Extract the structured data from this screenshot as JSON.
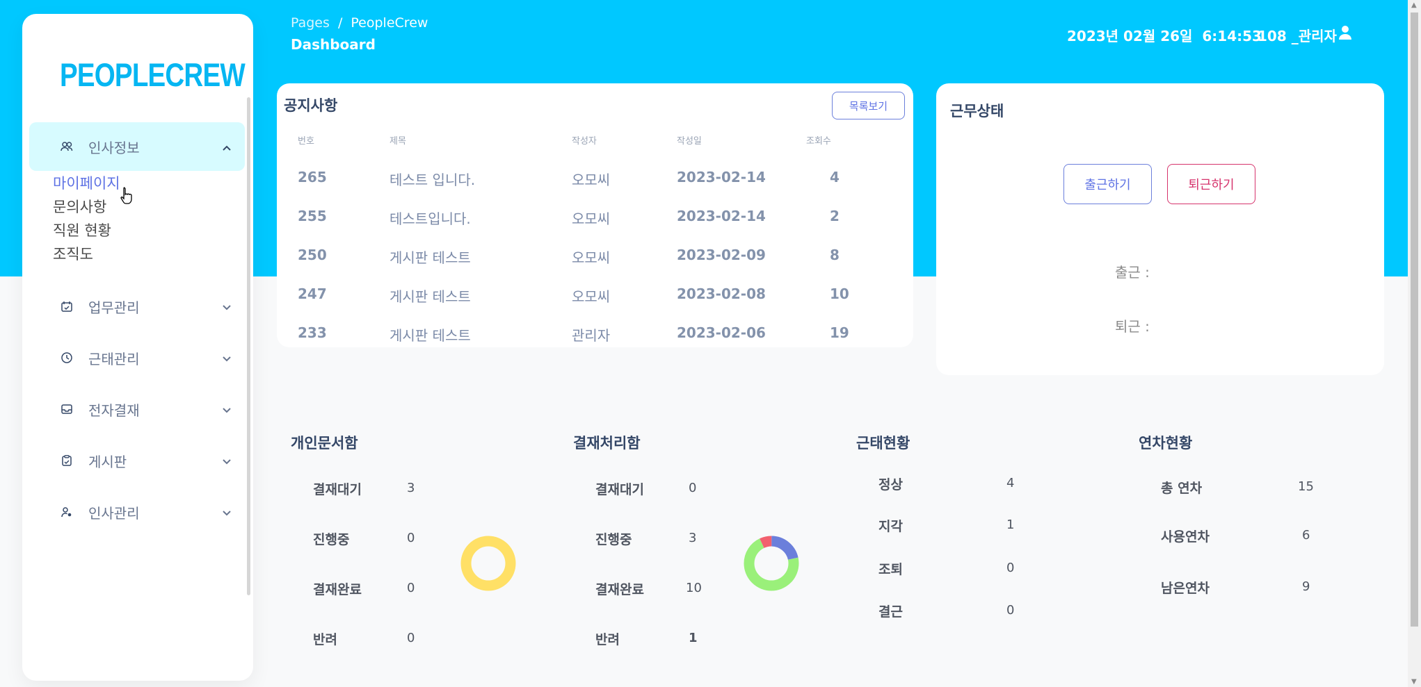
{
  "brand": {
    "logo": "PEOPLECREW"
  },
  "header": {
    "breadcrumb_root": "Pages",
    "breadcrumb_sep": "/",
    "breadcrumb_current": "PeopleCrew",
    "page_title": "Dashboard",
    "datetime": "2023년 02월 26일  6:14:53",
    "user": "108 _관리자"
  },
  "sidebar": {
    "items": [
      {
        "label": "인사정보",
        "icon": "people-icon",
        "expanded": true
      },
      {
        "label": "업무관리",
        "icon": "calendar-check-icon"
      },
      {
        "label": "근태관리",
        "icon": "clock-icon"
      },
      {
        "label": "전자결재",
        "icon": "inbox-icon"
      },
      {
        "label": "게시판",
        "icon": "clipboard-icon"
      },
      {
        "label": "인사관리",
        "icon": "user-gear-icon"
      }
    ],
    "sub_items": [
      "마이페이지",
      "문의사항",
      "직원 현황",
      "조직도"
    ]
  },
  "notice": {
    "title": "공지사항",
    "list_button": "목록보기",
    "columns": [
      "번호",
      "제목",
      "작성자",
      "작성일",
      "조회수"
    ],
    "rows": [
      [
        "265",
        "테스트 입니다.",
        "오모씨",
        "2023-02-14",
        "4"
      ],
      [
        "255",
        "테스트입니다.",
        "오모씨",
        "2023-02-14",
        "2"
      ],
      [
        "250",
        "게시판 테스트",
        "오모씨",
        "2023-02-09",
        "8"
      ],
      [
        "247",
        "게시판 테스트",
        "오모씨",
        "2023-02-08",
        "10"
      ],
      [
        "233",
        "게시판 테스트",
        "관리자",
        "2023-02-06",
        "19"
      ]
    ]
  },
  "work": {
    "title": "근무상태",
    "clock_in_button": "출근하기",
    "clock_out_button": "퇴근하기",
    "clock_in_label": "출근 :",
    "clock_out_label": "퇴근 :"
  },
  "summaries": {
    "personal": {
      "title": "개인문서함",
      "items": [
        [
          "결재대기",
          "3"
        ],
        [
          "진행중",
          "0"
        ],
        [
          "결재완료",
          "0"
        ],
        [
          "반려",
          "0"
        ]
      ]
    },
    "approval": {
      "title": "결재처리함",
      "items": [
        [
          "결재대기",
          "0"
        ],
        [
          "진행중",
          "3"
        ],
        [
          "결재완료",
          "10"
        ],
        [
          "반려",
          "1"
        ]
      ]
    },
    "attendance": {
      "title": "근태현황",
      "items": [
        [
          "정상",
          "4"
        ],
        [
          "지각",
          "1"
        ],
        [
          "조퇴",
          "0"
        ],
        [
          "결근",
          "0"
        ]
      ]
    },
    "leave": {
      "title": "연차현황",
      "items": [
        [
          "총 연차",
          "15"
        ],
        [
          "사용연차",
          "6"
        ],
        [
          "남은연차",
          "9"
        ]
      ]
    }
  },
  "chart_data": [
    {
      "type": "pie",
      "categories": [
        "결재대기",
        "진행중",
        "결재완료",
        "반려"
      ],
      "values": [
        3,
        0,
        0,
        0
      ],
      "colors": [
        "#ffe066",
        "#6b7fdb",
        "#9af07a",
        "#f2606e"
      ]
    },
    {
      "type": "pie",
      "categories": [
        "결재대기",
        "진행중",
        "결재완료",
        "반려"
      ],
      "values": [
        0,
        3,
        10,
        1
      ],
      "colors": [
        "#ffe066",
        "#6b7fdb",
        "#9af07a",
        "#f2606e"
      ]
    }
  ],
  "colors": {
    "accent": "#00c8ff",
    "primary": "#5e72e4",
    "danger": "#d6336c"
  }
}
